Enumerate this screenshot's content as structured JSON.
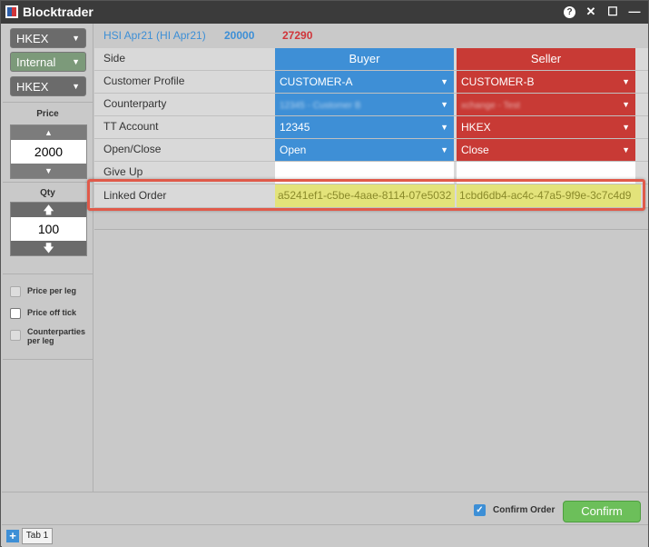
{
  "window": {
    "title": "Blocktrader",
    "icons": [
      "help-icon",
      "close-icon",
      "maximize-icon",
      "minimize-icon"
    ]
  },
  "left": {
    "exchange": "HKEX",
    "account_type": "Internal",
    "venue": "HKEX",
    "price_label": "Price",
    "price_value": "2000",
    "qty_label": "Qty",
    "qty_value": "100",
    "options": [
      "Price per leg",
      "Price off tick",
      "Counterparties per leg"
    ]
  },
  "header": {
    "instrument": "HSI Apr21 (HI Apr21)",
    "bid": "20000",
    "ask": "27290"
  },
  "rows": {
    "side": {
      "label": "Side",
      "buyer": "Buyer",
      "seller": "Seller"
    },
    "customer_profile": {
      "label": "Customer Profile",
      "buyer": "CUSTOMER-A",
      "seller": "CUSTOMER-B"
    },
    "counterparty": {
      "label": "Counterparty",
      "buyer": "12345 - Customer B",
      "seller": "xchange - Test"
    },
    "tt_account": {
      "label": "TT Account",
      "buyer": "12345",
      "seller": "HKEX"
    },
    "open_close": {
      "label": "Open/Close",
      "buyer": "Open",
      "seller": "Close"
    },
    "give_up": {
      "label": "Give Up",
      "buyer": "",
      "seller": ""
    },
    "linked_order": {
      "label": "Linked Order",
      "buyer": "a5241ef1-c5be-4aae-8114-07e5032",
      "seller": "1cbd6db4-ac4c-47a5-9f9e-3c7c4d9"
    }
  },
  "footer": {
    "confirm_order_label": "Confirm Order",
    "confirm_button": "Confirm"
  },
  "tabs": [
    {
      "label": "Tab 1"
    }
  ],
  "colors": {
    "buyer": "#3e8fd6",
    "seller": "#c83a35",
    "confirm": "#6cbf5a",
    "linked_highlight": "#e3e37a",
    "callout": "#e05a4a"
  }
}
